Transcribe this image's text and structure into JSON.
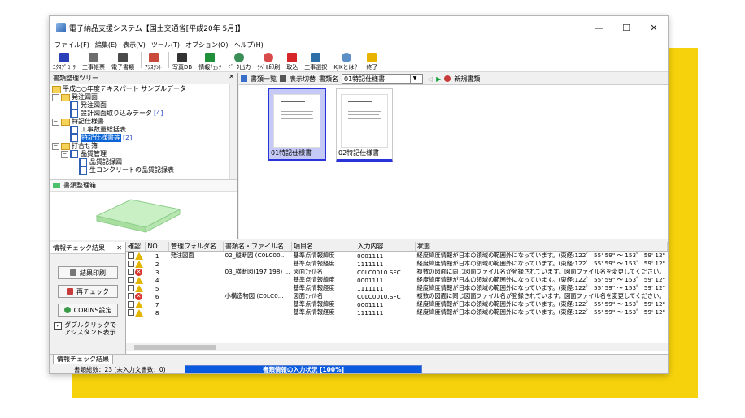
{
  "window": {
    "title": "電子納品支援システム【国土交通省[平成20年 5月]】",
    "controls": [
      "—",
      "☐",
      "✕"
    ]
  },
  "menu": [
    "ファイル(F)",
    "編集(E)",
    "表示(V)",
    "ツール(T)",
    "オプション(O)",
    "ヘルプ(H)"
  ],
  "toolbar": [
    {
      "label": "ｴｸｽﾌﾟﾛｰﾗ",
      "icon": "explorer-icon"
    },
    {
      "label": "工事帳票",
      "icon": "ledger-icon"
    },
    {
      "label": "電子書類",
      "icon": "edoc-icon"
    },
    {
      "label": "ｱｼｽﾀﾝﾄ",
      "icon": "assistant-icon"
    },
    {
      "label": "写真DB",
      "icon": "camera-icon"
    },
    {
      "label": "情報ﾁｪｯｸ",
      "icon": "check-icon"
    },
    {
      "label": "ﾃﾞｰﾀ出力",
      "icon": "export-icon"
    },
    {
      "label": "ﾗﾍﾞﾙ印刷",
      "icon": "label-print-icon"
    },
    {
      "label": "取込",
      "icon": "import-icon"
    },
    {
      "label": "工事選択",
      "icon": "project-select-icon"
    },
    {
      "label": "KJKとは？",
      "icon": "help-globe-icon"
    },
    {
      "label": "終了",
      "icon": "exit-icon"
    }
  ],
  "tree_panel": {
    "title": "書類整理ツリー",
    "items": [
      "平成○○年度テキスパート サンプルデータ",
      "発注図面",
      "発注図面",
      "設計図面取り込みデータ",
      "[4]",
      "特記仕様書",
      "工事数量総括表",
      "特記仕様書等",
      "[2]",
      "打合せ簿",
      "品質管理",
      "品質記録図",
      "生コンクリートの品質記録表"
    ]
  },
  "box_panel": {
    "title": "書類整理箱"
  },
  "doc_toolbar": {
    "list_label": "書類一覧",
    "toggle_label": "表示切替",
    "name_label": "書類名",
    "combo_value": "01特記仕様書",
    "new_label": "新規書類"
  },
  "cards": [
    {
      "label": "01特記仕様書"
    },
    {
      "label": "02特記仕様書"
    }
  ],
  "check_panel": {
    "title": "情報チェック結果",
    "result_print": "結果印刷",
    "recheck": "再チェック",
    "corins": "CORINS設定",
    "dblclick_line1": "ダブルクリックで",
    "dblclick_line2": "アシスタント表示"
  },
  "grid": {
    "headers": [
      "確認",
      "NO.",
      "管理フォルダ名",
      "書類名・ファイル名",
      "項目名",
      "入力内容",
      "状態"
    ],
    "rows": [
      {
        "icon": "warn",
        "no": "1",
        "folder": "発注図面",
        "doc": "02_縦断図 (C0LC00...",
        "item": "基準点情報緯度",
        "input": "0001111",
        "state": "経度緯度情報が日本の領域の範囲外になっています。(東経:122゜ 55' 59\" ～ 153゜ 59' 12\""
      },
      {
        "icon": "warn",
        "no": "2",
        "folder": "",
        "doc": "",
        "item": "基準点情報経度",
        "input": "1111111",
        "state": "経度緯度情報が日本の領域の範囲外になっています。(東経:122゜ 55' 59\" ～ 153゜ 59' 12\""
      },
      {
        "icon": "err",
        "no": "3",
        "folder": "",
        "doc": "03_横断図(197,198) ...",
        "item": "図面ﾌｧｲﾙ名",
        "input": "C0LC0010.SFC",
        "state": "複数の図面に同じ図面ファイル名が登録されています。図面ファイル名を変更してください。"
      },
      {
        "icon": "warn",
        "no": "4",
        "folder": "",
        "doc": "",
        "item": "基準点情報緯度",
        "input": "0001111",
        "state": "経度緯度情報が日本の領域の範囲外になっています。(東経:122゜ 55' 59\" ～ 153゜ 59' 12\""
      },
      {
        "icon": "warn",
        "no": "5",
        "folder": "",
        "doc": "",
        "item": "基準点情報経度",
        "input": "1111111",
        "state": "経度緯度情報が日本の領域の範囲外になっています。(東経:122゜ 55' 59\" ～ 153゜ 59' 12\""
      },
      {
        "icon": "err",
        "no": "6",
        "folder": "",
        "doc": "小構造物図 (C0LC0...",
        "item": "図面ﾌｧｲﾙ名",
        "input": "C0LC0010.SFC",
        "state": "複数の図面に同じ図面ファイル名が登録されています。図面ファイル名を変更してください。"
      },
      {
        "icon": "warn",
        "no": "7",
        "folder": "",
        "doc": "",
        "item": "基準点情報緯度",
        "input": "0001111",
        "state": "経度緯度情報が日本の領域の範囲外になっています。(東経:122゜ 55' 59\" ～ 153゜ 59' 12\""
      },
      {
        "icon": "warn",
        "no": "8",
        "folder": "",
        "doc": "",
        "item": "基準点情報経度",
        "input": "1111111",
        "state": "経度緯度情報が日本の領域の範囲外になっています。(東経:122゜ 55' 59\" ～ 153゜ 59' 12\""
      }
    ]
  },
  "bottom_tab": "情報チェック結果",
  "status": {
    "count": "書類総数：23 (未入力文書数：0)",
    "progress": "書類情報の入力状況 [100%]"
  },
  "colors": {
    "accent": "#f6d20c",
    "selection": "#0a64d6",
    "progress": "#0a5ae0",
    "card_border": "#2a33d8"
  }
}
